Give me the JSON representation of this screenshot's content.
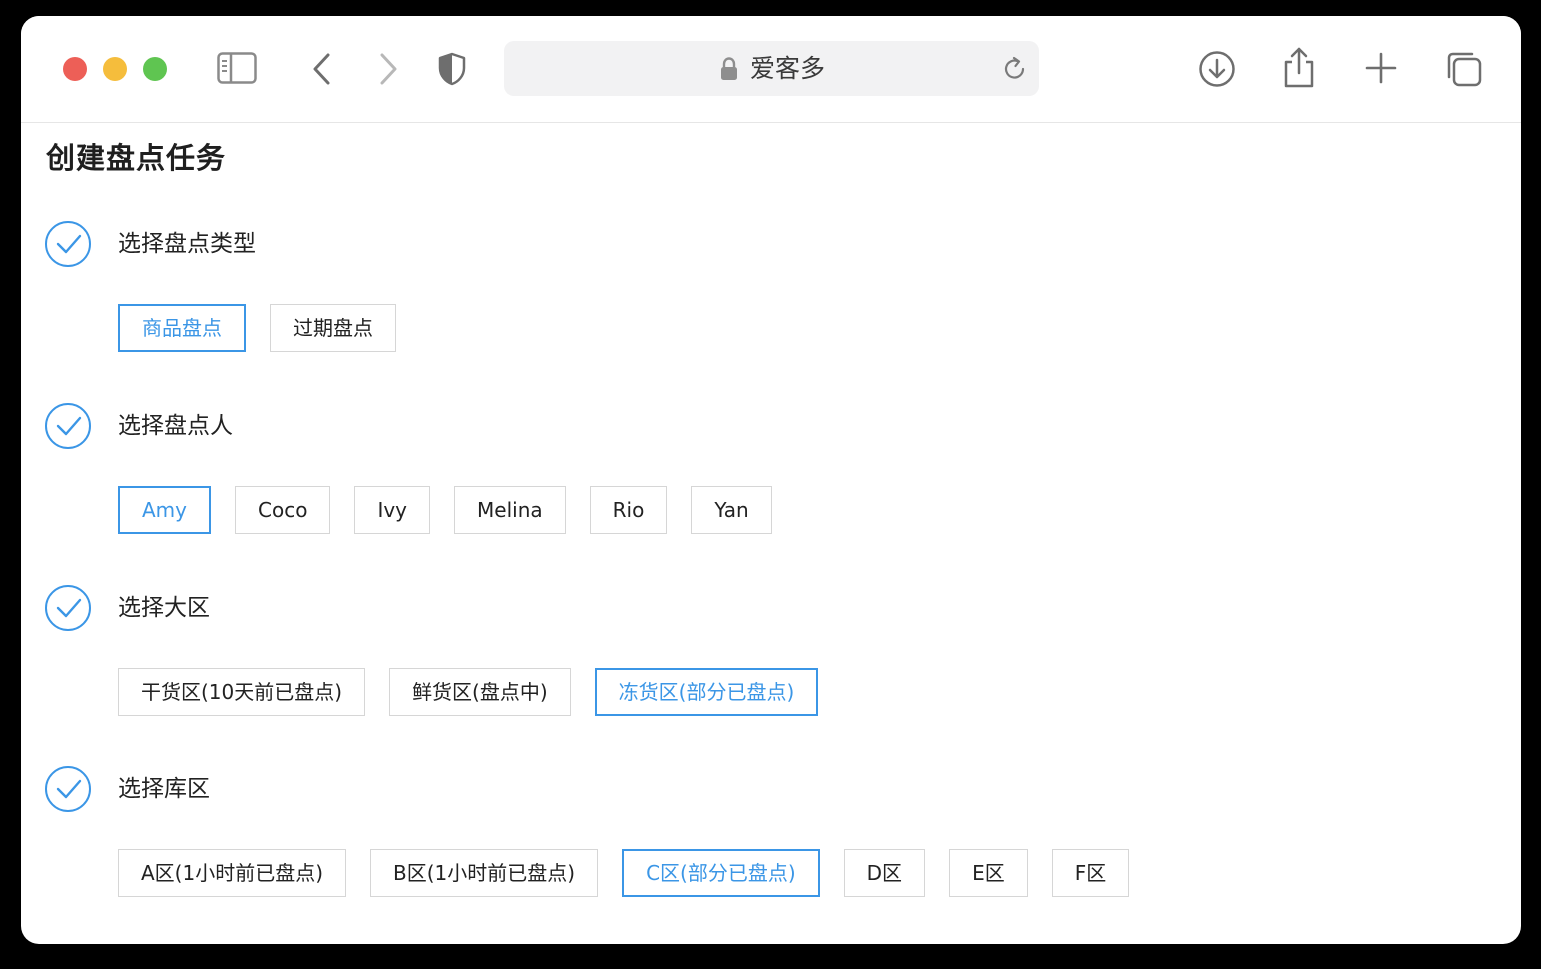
{
  "browser": {
    "address": "爱客多"
  },
  "page": {
    "title": "创建盘点任务"
  },
  "colors": {
    "accent": "#3b96e6",
    "border": "#d6d6d6",
    "text": "#222222"
  },
  "sections": [
    {
      "label": "选择盘点类型",
      "options": [
        {
          "label": "商品盘点",
          "selected": true
        },
        {
          "label": "过期盘点",
          "selected": false
        }
      ]
    },
    {
      "label": "选择盘点人",
      "options": [
        {
          "label": "Amy",
          "selected": true
        },
        {
          "label": "Coco",
          "selected": false
        },
        {
          "label": "Ivy",
          "selected": false
        },
        {
          "label": "Melina",
          "selected": false
        },
        {
          "label": "Rio",
          "selected": false
        },
        {
          "label": "Yan",
          "selected": false
        }
      ]
    },
    {
      "label": "选择大区",
      "options": [
        {
          "label": "干货区(10天前已盘点)",
          "selected": false
        },
        {
          "label": "鲜货区(盘点中)",
          "selected": false
        },
        {
          "label": "冻货区(部分已盘点)",
          "selected": true
        }
      ]
    },
    {
      "label": "选择库区",
      "options": [
        {
          "label": "A区(1小时前已盘点)",
          "selected": false
        },
        {
          "label": "B区(1小时前已盘点)",
          "selected": false
        },
        {
          "label": "C区(部分已盘点)",
          "selected": true
        },
        {
          "label": "D区",
          "selected": false
        },
        {
          "label": "E区",
          "selected": false
        },
        {
          "label": "F区",
          "selected": false
        }
      ]
    }
  ]
}
